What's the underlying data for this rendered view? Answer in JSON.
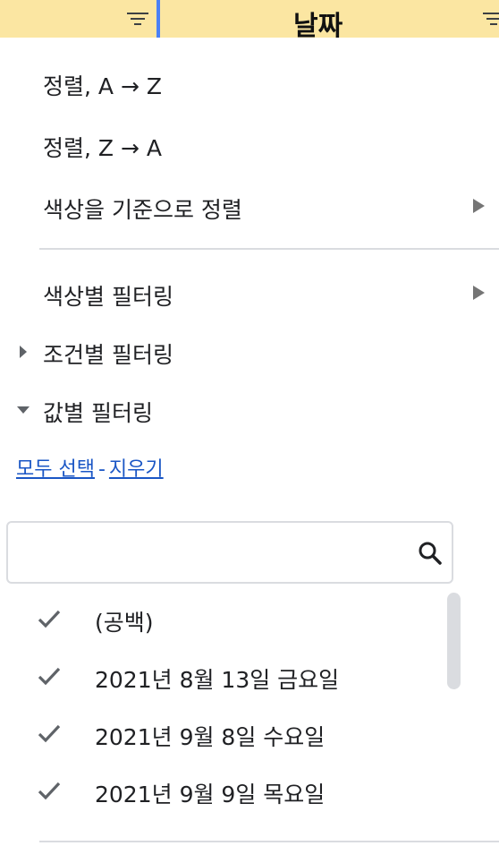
{
  "header": {
    "column_title": "날짜",
    "accent_color": "#fbe6a2",
    "divider_color": "#4a80f5"
  },
  "menu": {
    "sort_az": "정렬, A → Z",
    "sort_za": "정렬, Z → A",
    "sort_by_color": "색상을 기준으로 정렬",
    "filter_by_color": "색상별 필터링",
    "filter_by_condition": "조건별 필터링",
    "filter_by_values": "값별 필터링"
  },
  "links": {
    "select_all": "모두 선택",
    "separator": "-",
    "clear": "지우기",
    "link_color": "#1a56c5"
  },
  "search": {
    "value": "",
    "placeholder": "",
    "icon": "search-icon"
  },
  "values": [
    {
      "label": "(공백)",
      "checked": true
    },
    {
      "label": "2021년 8월 13일 금요일",
      "checked": true
    },
    {
      "label": "2021년 9월 8일 수요일",
      "checked": true
    },
    {
      "label": "2021년 9월 9일 목요일",
      "checked": true
    }
  ]
}
